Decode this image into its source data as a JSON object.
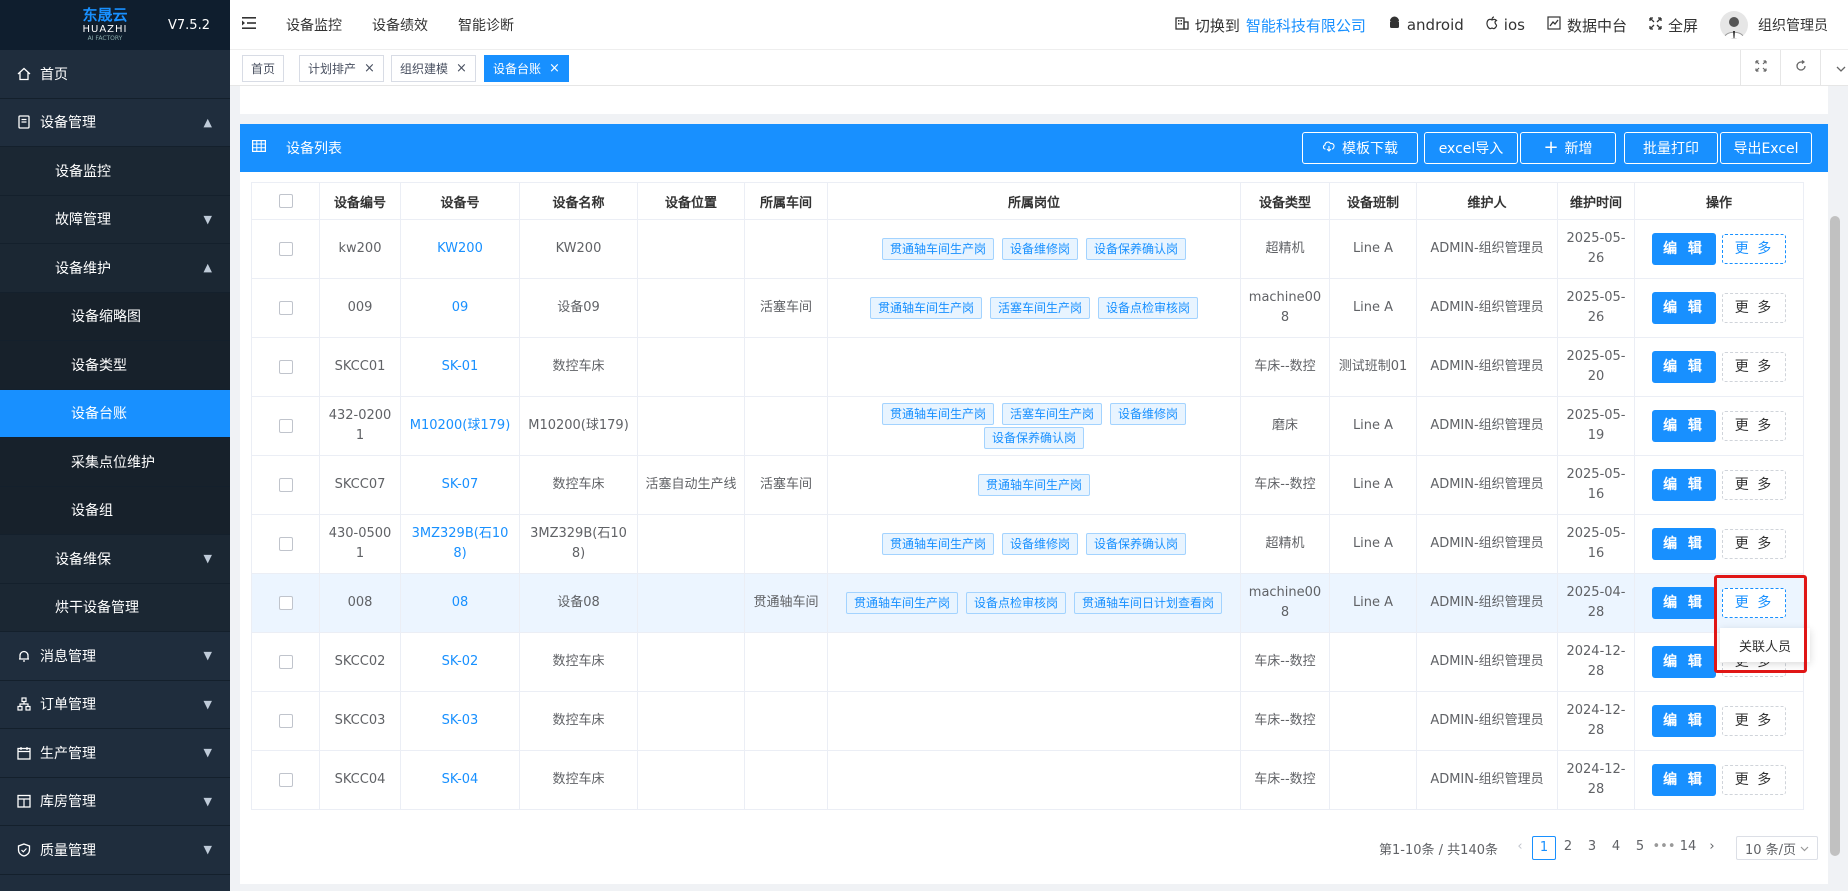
{
  "app": {
    "logo_cn": "东晟云",
    "logo_en": "HUAZHI",
    "logo_sub": "AI FACTORY",
    "version": "V7.5.2"
  },
  "sidebar": {
    "items": [
      {
        "label": "首页",
        "icon": "home-icon",
        "level": 1
      },
      {
        "label": "设备管理",
        "icon": "device-icon",
        "level": 1,
        "arrow": "▲"
      },
      {
        "label": "设备监控",
        "level": 2
      },
      {
        "label": "故障管理",
        "level": 2,
        "arrow": "▼"
      },
      {
        "label": "设备维护",
        "level": 2,
        "arrow": "▲"
      },
      {
        "label": "设备缩略图",
        "level": 3
      },
      {
        "label": "设备类型",
        "level": 3
      },
      {
        "label": "设备台账",
        "level": 3,
        "active": true
      },
      {
        "label": "采集点位维护",
        "level": 3
      },
      {
        "label": "设备组",
        "level": 3
      },
      {
        "label": "设备维保",
        "level": 2,
        "arrow": "▼"
      },
      {
        "label": "烘干设备管理",
        "level": 2
      },
      {
        "label": "消息管理",
        "icon": "bell-icon",
        "level": 1,
        "arrow": "▼"
      },
      {
        "label": "订单管理",
        "icon": "order-icon",
        "level": 1,
        "arrow": "▼"
      },
      {
        "label": "生产管理",
        "icon": "calendar-icon",
        "level": 1,
        "arrow": "▼"
      },
      {
        "label": "库房管理",
        "icon": "warehouse-icon",
        "level": 1,
        "arrow": "▼"
      },
      {
        "label": "质量管理",
        "icon": "shield-icon",
        "level": 1,
        "arrow": "▼"
      }
    ]
  },
  "topbar": {
    "nav": [
      "设备监控",
      "设备绩效",
      "智能诊断"
    ],
    "switch_label": "切换到",
    "company": "智能科技有限公司",
    "android": "android",
    "ios": "ios",
    "data_center": "数据中台",
    "fullscreen": "全屏",
    "user": "组织管理员"
  },
  "tags": [
    {
      "label": "首页",
      "closable": false
    },
    {
      "label": "计划排产",
      "closable": true
    },
    {
      "label": "组织建模",
      "closable": true
    },
    {
      "label": "设备台账",
      "closable": true,
      "active": true
    }
  ],
  "panel": {
    "title": "设备列表",
    "buttons": {
      "template": "模板下载",
      "import": "excel导入",
      "add": "新增",
      "print": "批量打印",
      "export": "导出Excel"
    }
  },
  "table": {
    "headers": [
      "",
      "设备编号",
      "设备号",
      "设备名称",
      "设备位置",
      "所属车间",
      "所属岗位",
      "设备类型",
      "设备班制",
      "维护人",
      "维护时间",
      "操作"
    ],
    "edit_label": "编 辑",
    "more_label": "更 多",
    "rows": [
      {
        "code": "kw200",
        "no": "KW200",
        "name": "KW200",
        "loc": "",
        "shop": "",
        "posts": [
          "贯通轴车间生产岗",
          "设备维修岗",
          "设备保养确认岗"
        ],
        "type": "超精机",
        "shift": "Line A",
        "maint": "ADMIN-组织管理员",
        "time": "2025-05-26",
        "more_active": true
      },
      {
        "code": "009",
        "no": "09",
        "name": "设备09",
        "loc": "",
        "shop": "活塞车间",
        "posts": [
          "贯通轴车间生产岗",
          "活塞车间生产岗",
          "设备点检审核岗"
        ],
        "type": "machine008",
        "shift": "Line A",
        "maint": "ADMIN-组织管理员",
        "time": "2025-05-26"
      },
      {
        "code": "SKCC01",
        "no": "SK-01",
        "name": "数控车床",
        "loc": "",
        "shop": "",
        "posts": [],
        "type": "车床--数控",
        "shift": "测试班制01",
        "maint": "ADMIN-组织管理员",
        "time": "2025-05-20"
      },
      {
        "code": "432-02001",
        "no": "M10200(球179)",
        "name": "M10200(球179)",
        "loc": "",
        "shop": "",
        "posts": [
          "贯通轴车间生产岗",
          "活塞车间生产岗",
          "设备维修岗",
          "设备保养确认岗"
        ],
        "type": "磨床",
        "shift": "Line A",
        "maint": "ADMIN-组织管理员",
        "time": "2025-05-19"
      },
      {
        "code": "SKCC07",
        "no": "SK-07",
        "name": "数控车床",
        "loc": "活塞自动生产线",
        "shop": "活塞车间",
        "posts": [
          "贯通轴车间生产岗"
        ],
        "type": "车床--数控",
        "shift": "Line A",
        "maint": "ADMIN-组织管理员",
        "time": "2025-05-16"
      },
      {
        "code": "430-05001",
        "no": "3MZ329B(石108)",
        "name": "3MZ329B(石108)",
        "loc": "",
        "shop": "",
        "posts": [
          "贯通轴车间生产岗",
          "设备维修岗",
          "设备保养确认岗"
        ],
        "type": "超精机",
        "shift": "Line A",
        "maint": "ADMIN-组织管理员",
        "time": "2025-05-16"
      },
      {
        "code": "008",
        "no": "08",
        "name": "设备08",
        "loc": "",
        "shop": "贯通轴车间",
        "posts": [
          "贯通轴车间生产岗",
          "设备点检审核岗",
          "贯通轴车间日计划查看岗"
        ],
        "type": "machine008",
        "shift": "Line A",
        "maint": "ADMIN-组织管理员",
        "time": "2025-04-28",
        "highlight": true,
        "more_active": true
      },
      {
        "code": "SKCC02",
        "no": "SK-02",
        "name": "数控车床",
        "loc": "",
        "shop": "",
        "posts": [],
        "type": "车床--数控",
        "shift": "",
        "maint": "ADMIN-组织管理员",
        "time": "2024-12-28"
      },
      {
        "code": "SKCC03",
        "no": "SK-03",
        "name": "数控车床",
        "loc": "",
        "shop": "",
        "posts": [],
        "type": "车床--数控",
        "shift": "",
        "maint": "ADMIN-组织管理员",
        "time": "2024-12-28"
      },
      {
        "code": "SKCC04",
        "no": "SK-04",
        "name": "数控车床",
        "loc": "",
        "shop": "",
        "posts": [],
        "type": "车床--数控",
        "shift": "",
        "maint": "ADMIN-组织管理员",
        "time": "2024-12-28"
      }
    ]
  },
  "pagination": {
    "summary": "第1-10条 / 共140条",
    "pages": [
      "1",
      "2",
      "3",
      "4",
      "5",
      "•••",
      "14"
    ],
    "current": "1",
    "page_size": "10 条/页"
  },
  "dropdown": {
    "item": "关联人员"
  },
  "colors": {
    "primary": "#1890ff",
    "sidebar": "#1f2d3d",
    "highlight_box": "#e01616"
  }
}
